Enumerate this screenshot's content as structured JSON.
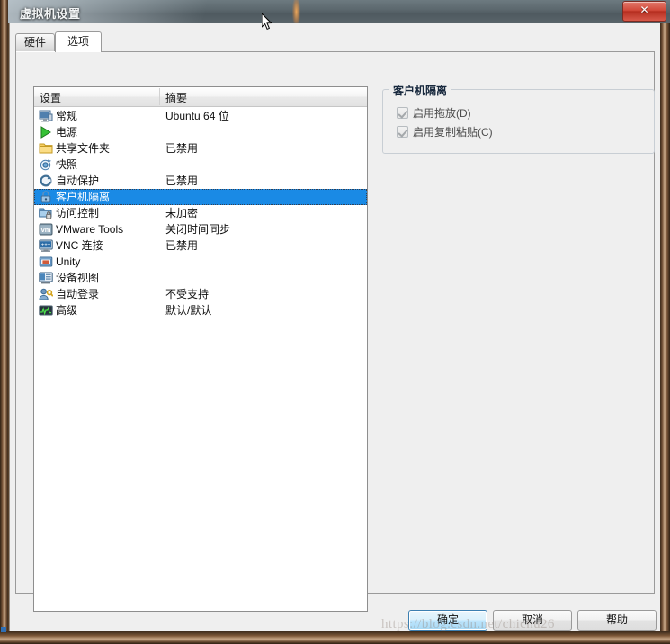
{
  "window": {
    "title": "虚拟机设置",
    "close_label": "✕",
    "close_icon": "close-icon"
  },
  "tabs": [
    {
      "label": "硬件",
      "active": false
    },
    {
      "label": "选项",
      "active": true
    }
  ],
  "list": {
    "columns": [
      "设置",
      "摘要"
    ],
    "rows": [
      {
        "icon": "monitor-icon",
        "label": "常规",
        "summary": "Ubuntu 64 位",
        "selected": false
      },
      {
        "icon": "play-icon",
        "label": "电源",
        "summary": "",
        "selected": false
      },
      {
        "icon": "folder-icon",
        "label": "共享文件夹",
        "summary": "已禁用",
        "selected": false
      },
      {
        "icon": "camera-icon",
        "label": "快照",
        "summary": "",
        "selected": false
      },
      {
        "icon": "refresh-clock-icon",
        "label": "自动保护",
        "summary": "已禁用",
        "selected": false
      },
      {
        "icon": "lock-icon",
        "label": "客户机隔离",
        "summary": "",
        "selected": true
      },
      {
        "icon": "folder-lock-icon",
        "label": "访问控制",
        "summary": "未加密",
        "selected": false
      },
      {
        "icon": "vm-tools-icon",
        "label": "VMware Tools",
        "summary": "关闭时间同步",
        "selected": false
      },
      {
        "icon": "vnc-monitor-icon",
        "label": "VNC 连接",
        "summary": "已禁用",
        "selected": false
      },
      {
        "icon": "unity-window-icon",
        "label": "Unity",
        "summary": "",
        "selected": false
      },
      {
        "icon": "device-view-icon",
        "label": "设备视图",
        "summary": "",
        "selected": false
      },
      {
        "icon": "auto-login-icon",
        "label": "自动登录",
        "summary": "不受支持",
        "selected": false
      },
      {
        "icon": "advanced-icon",
        "label": "高级",
        "summary": "默认/默认",
        "selected": false
      }
    ]
  },
  "isolation_panel": {
    "legend": "客户机隔离",
    "checkboxes": [
      {
        "label": "启用拖放(D)",
        "checked": true,
        "disabled": true
      },
      {
        "label": "启用复制粘贴(C)",
        "checked": true,
        "disabled": true
      }
    ]
  },
  "footer": {
    "ok": "确定",
    "cancel": "取消",
    "help": "帮助"
  },
  "watermark": "https://blog.csdn.net/chichu26",
  "colors": {
    "selection": "#1a8ae5",
    "titlebar": "#5c686e",
    "close": "#c3392b",
    "dialog_bg": "#efefef",
    "frame": "#6b4a30"
  }
}
